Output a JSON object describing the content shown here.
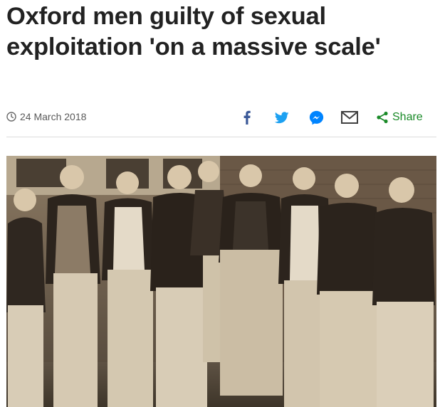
{
  "article": {
    "headline": "Oxford men guilty of sexual exploitation 'on a massive scale'",
    "date": "24 March 2018"
  },
  "share": {
    "label": "Share",
    "icons": [
      "facebook-icon",
      "twitter-icon",
      "messenger-icon",
      "email-icon",
      "share-icon"
    ]
  },
  "colors": {
    "headline": "#222222",
    "facebook": "#3b5998",
    "twitter": "#1da1f2",
    "messenger": "#0084ff",
    "email": "#404040",
    "share": "#1a8a28"
  },
  "image": {
    "description_icon": "sepia-group-photo"
  }
}
